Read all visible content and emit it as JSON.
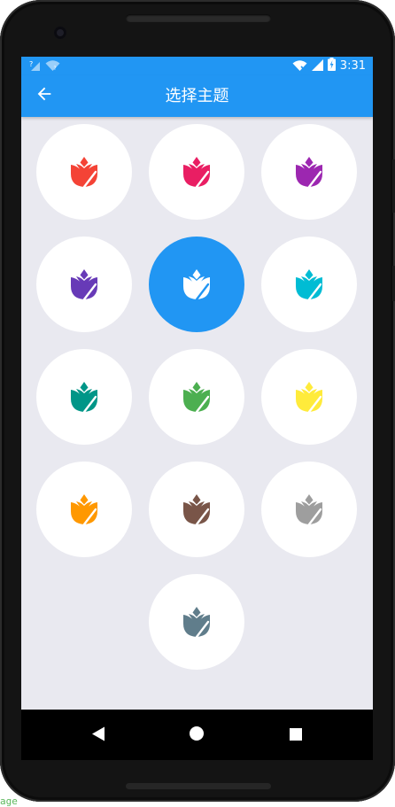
{
  "status_bar": {
    "time": "3:31",
    "icons": [
      "signal-unknown-icon",
      "wifi-unknown-icon",
      "wifi-off-icon",
      "cell-signal-icon",
      "battery-charging-icon"
    ]
  },
  "app_bar": {
    "title": "选择主题",
    "back_icon": "arrow-back-icon"
  },
  "themes": [
    {
      "name": "red",
      "color": "#f44336",
      "selected": false
    },
    {
      "name": "pink",
      "color": "#e91e63",
      "selected": false
    },
    {
      "name": "purple",
      "color": "#9c27b0",
      "selected": false
    },
    {
      "name": "deep-purple",
      "color": "#673ab7",
      "selected": false
    },
    {
      "name": "blue",
      "color": "#2196f3",
      "selected": true
    },
    {
      "name": "cyan",
      "color": "#00bcd4",
      "selected": false
    },
    {
      "name": "teal",
      "color": "#009688",
      "selected": false
    },
    {
      "name": "green",
      "color": "#4caf50",
      "selected": false
    },
    {
      "name": "yellow",
      "color": "#ffeb3b",
      "selected": false
    },
    {
      "name": "orange",
      "color": "#ff9800",
      "selected": false
    },
    {
      "name": "brown",
      "color": "#795548",
      "selected": false
    },
    {
      "name": "grey",
      "color": "#9e9e9e",
      "selected": false
    },
    {
      "name": "blue-grey",
      "color": "#607d8b",
      "selected": false
    }
  ],
  "nav_bar": {
    "buttons": [
      "back-triangle-icon",
      "home-circle-icon",
      "recents-square-icon"
    ]
  },
  "watermark": "age"
}
